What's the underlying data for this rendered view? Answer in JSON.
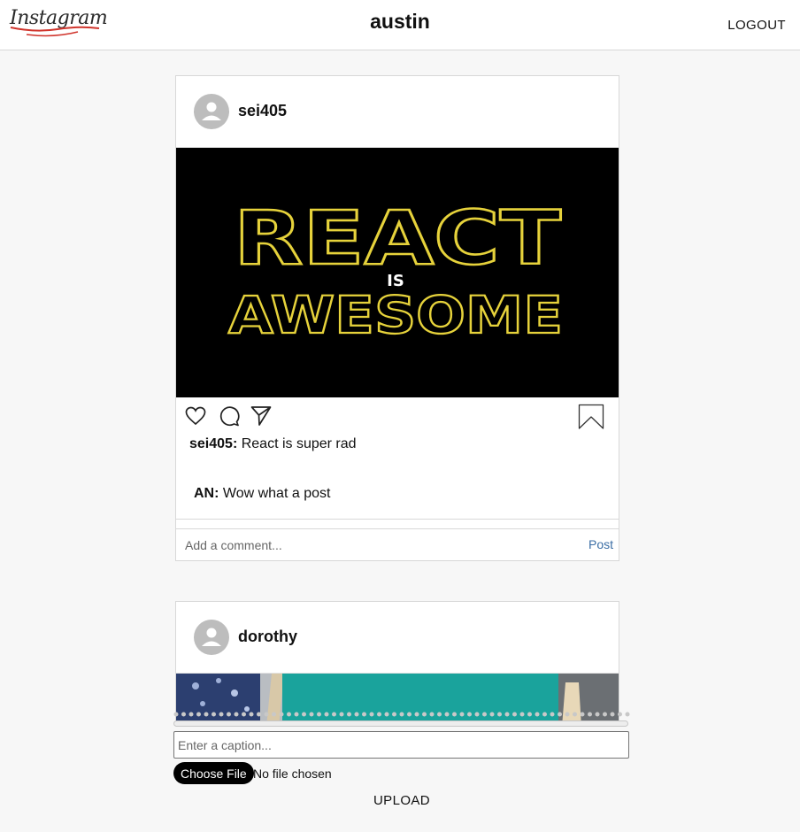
{
  "header": {
    "logo": "Instagram",
    "username": "austin",
    "logout_label": "LOGOUT"
  },
  "posts": [
    {
      "username": "sei405",
      "image_text": {
        "line1": "REACT",
        "line2": "IS",
        "line3": "AWESOME"
      },
      "caption": {
        "username": "sei405:",
        "text": "React is super rad"
      },
      "comments": [
        {
          "username": "AN:",
          "text": "Wow what a post"
        }
      ],
      "comment_placeholder": "Add a comment...",
      "post_label": "Post"
    },
    {
      "username": "dorothy"
    }
  ],
  "upload": {
    "caption_placeholder": "Enter a caption...",
    "choose_file_label": "Choose File",
    "file_status": "No file chosen",
    "upload_label": "UPLOAD",
    "progress": 0
  },
  "colors": {
    "link_blue": "#3b6ea5",
    "star_wars_yellow": "#e6d23b",
    "logo_strike_red": "#d0342c"
  }
}
